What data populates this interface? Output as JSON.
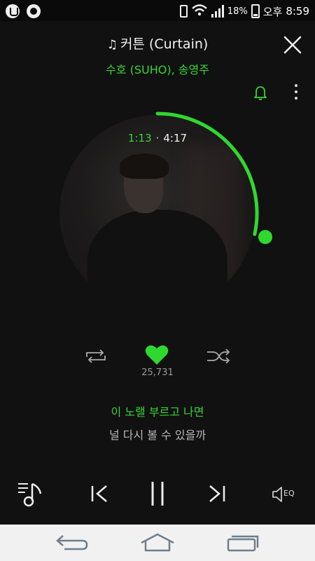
{
  "status_bar": {
    "battery": "18%",
    "period": "오후",
    "clock": "8:59"
  },
  "track": {
    "title": "커튼 (Curtain)",
    "title_icon": "music-note-icon",
    "artist": "수호 (SUHO), 송영주"
  },
  "playback": {
    "elapsed": "1:13",
    "separator": "·",
    "total": "4:17",
    "progress": 0.284
  },
  "actions": {
    "like_count": "25,731",
    "eq_label": "EQ"
  },
  "lyrics": {
    "current": "이 노랠 부르고 나면",
    "next": "널 다시 볼 수 있을까"
  },
  "colors": {
    "accent": "#2fd82f",
    "background": "#111111"
  }
}
